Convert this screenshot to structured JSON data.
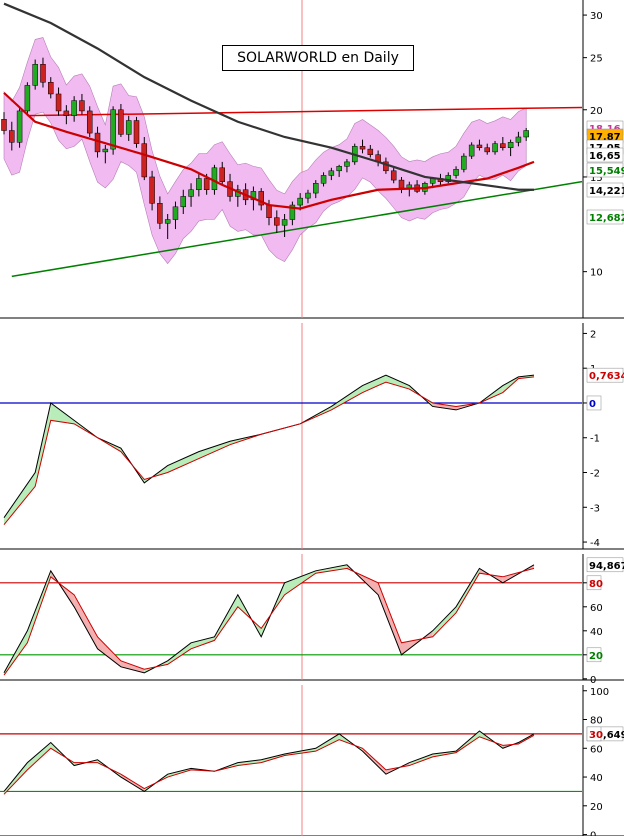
{
  "title": "SOLARWORLD en Daily",
  "chart_data": [
    {
      "type": "candlestick",
      "title": "SOLARWORLD en Daily",
      "yscale": "log",
      "ylim": [
        8.2,
        32
      ],
      "y_ticks": [
        10,
        15,
        20,
        25,
        30
      ],
      "candles": [
        [
          19.2,
          19.8,
          18.0,
          18.3
        ],
        [
          18.3,
          19.0,
          16.8,
          17.4
        ],
        [
          17.4,
          20.2,
          17.0,
          19.9
        ],
        [
          19.9,
          22.5,
          19.5,
          22.2
        ],
        [
          22.2,
          24.8,
          21.8,
          24.3
        ],
        [
          24.3,
          25.0,
          22.0,
          22.5
        ],
        [
          22.5,
          23.0,
          21.0,
          21.4
        ],
        [
          21.4,
          22.0,
          19.5,
          19.9
        ],
        [
          19.9,
          20.4,
          18.8,
          19.5
        ],
        [
          19.5,
          21.2,
          19.0,
          20.8
        ],
        [
          20.8,
          21.4,
          19.6,
          19.9
        ],
        [
          19.9,
          20.3,
          17.8,
          18.1
        ],
        [
          18.1,
          18.6,
          16.3,
          16.7
        ],
        [
          16.7,
          17.2,
          15.9,
          16.9
        ],
        [
          16.9,
          20.3,
          16.5,
          20.0
        ],
        [
          20.0,
          20.5,
          17.8,
          18.0
        ],
        [
          18.0,
          19.5,
          17.5,
          19.1
        ],
        [
          19.1,
          19.4,
          17.0,
          17.3
        ],
        [
          17.3,
          17.8,
          14.8,
          15.0
        ],
        [
          15.0,
          15.4,
          13.0,
          13.4
        ],
        [
          13.4,
          13.8,
          12.0,
          12.3
        ],
        [
          12.3,
          12.8,
          11.5,
          12.5
        ],
        [
          12.5,
          13.5,
          12.0,
          13.2
        ],
        [
          13.2,
          14.2,
          12.8,
          13.8
        ],
        [
          13.8,
          14.6,
          13.2,
          14.2
        ],
        [
          14.2,
          15.2,
          13.8,
          14.9
        ],
        [
          14.9,
          15.2,
          13.9,
          14.2
        ],
        [
          14.2,
          15.8,
          13.9,
          15.6
        ],
        [
          15.6,
          16.0,
          14.5,
          14.7
        ],
        [
          14.7,
          15.2,
          13.5,
          13.8
        ],
        [
          13.8,
          14.5,
          13.2,
          14.2
        ],
        [
          14.2,
          14.6,
          13.3,
          13.6
        ],
        [
          13.6,
          14.4,
          13.0,
          14.1
        ],
        [
          14.1,
          14.3,
          13.0,
          13.3
        ],
        [
          13.3,
          13.6,
          12.2,
          12.6
        ],
        [
          12.6,
          13.0,
          11.8,
          12.2
        ],
        [
          12.2,
          12.8,
          11.6,
          12.5
        ],
        [
          12.5,
          13.5,
          12.2,
          13.3
        ],
        [
          13.3,
          14.0,
          13.0,
          13.7
        ],
        [
          13.7,
          14.2,
          13.4,
          14.0
        ],
        [
          14.0,
          14.8,
          13.7,
          14.6
        ],
        [
          14.6,
          15.3,
          14.4,
          15.1
        ],
        [
          15.1,
          15.6,
          14.8,
          15.4
        ],
        [
          15.4,
          15.8,
          15.0,
          15.7
        ],
        [
          15.7,
          16.2,
          15.3,
          16.0
        ],
        [
          16.0,
          17.3,
          15.8,
          17.1
        ],
        [
          17.1,
          17.6,
          16.6,
          16.9
        ],
        [
          16.9,
          17.2,
          16.3,
          16.5
        ],
        [
          16.5,
          16.8,
          15.7,
          16.0
        ],
        [
          16.0,
          16.3,
          15.2,
          15.4
        ],
        [
          15.4,
          15.7,
          14.6,
          14.8
        ],
        [
          14.8,
          15.0,
          14.0,
          14.3
        ],
        [
          14.3,
          14.7,
          13.8,
          14.5
        ],
        [
          14.5,
          14.8,
          14.0,
          14.1
        ],
        [
          14.1,
          14.7,
          13.9,
          14.6
        ],
        [
          14.6,
          15.0,
          14.3,
          14.9
        ],
        [
          14.9,
          15.2,
          14.5,
          14.7
        ],
        [
          14.7,
          15.3,
          14.6,
          15.1
        ],
        [
          15.1,
          15.7,
          14.9,
          15.5
        ],
        [
          15.5,
          16.6,
          15.3,
          16.4
        ],
        [
          16.4,
          17.4,
          16.2,
          17.2
        ],
        [
          17.2,
          17.6,
          16.8,
          17.0
        ],
        [
          17.0,
          17.3,
          16.5,
          16.7
        ],
        [
          16.7,
          17.5,
          16.5,
          17.3
        ],
        [
          17.3,
          17.8,
          16.8,
          17.0
        ],
        [
          17.0,
          17.6,
          16.4,
          17.4
        ],
        [
          17.4,
          18.2,
          17.1,
          17.8
        ],
        [
          17.8,
          18.5,
          17.5,
          18.3
        ]
      ],
      "series": [
        {
          "name": "",
          "color": "#cc0000",
          "points": [
            [
              0,
              21.5
            ],
            [
              4,
              19.0
            ],
            [
              8,
              18.2
            ],
            [
              12,
              17.5
            ],
            [
              18,
              16.5
            ],
            [
              24,
              15.5
            ],
            [
              28,
              14.5
            ],
            [
              34,
              13.3
            ],
            [
              38,
              13.1
            ],
            [
              42,
              13.6
            ],
            [
              48,
              14.2
            ],
            [
              54,
              14.3
            ],
            [
              58,
              14.6
            ],
            [
              62,
              14.9
            ],
            [
              66,
              15.6
            ],
            [
              68,
              16.0
            ]
          ]
        },
        {
          "name": "",
          "color": "#333333",
          "points": [
            [
              0,
              31.5
            ],
            [
              6,
              29.0
            ],
            [
              12,
              26.0
            ],
            [
              18,
              23.0
            ],
            [
              24,
              20.8
            ],
            [
              30,
              19.0
            ],
            [
              36,
              17.8
            ],
            [
              42,
              17.0
            ],
            [
              48,
              16.0
            ],
            [
              54,
              15.0
            ],
            [
              60,
              14.6
            ],
            [
              66,
              14.2
            ],
            [
              68,
              14.2
            ]
          ]
        }
      ],
      "annotations": [
        "18,16",
        "17,87",
        "17,05",
        "16,65",
        "15,549",
        "14,221",
        "12,682"
      ]
    },
    {
      "type": "line",
      "ylim": [
        -4.2,
        2.3
      ],
      "y_ticks": [
        -4,
        -3,
        -2,
        -1,
        0,
        1,
        2
      ],
      "series": [
        {
          "name": "",
          "color": "#000000",
          "points": [
            [
              0,
              -3.3
            ],
            [
              4,
              -2.0
            ],
            [
              6,
              0.0
            ],
            [
              9,
              -0.5
            ],
            [
              12,
              -1.0
            ],
            [
              15,
              -1.3
            ],
            [
              18,
              -2.3
            ],
            [
              21,
              -1.8
            ],
            [
              25,
              -1.4
            ],
            [
              29,
              -1.1
            ],
            [
              33,
              -0.9
            ],
            [
              38,
              -0.6
            ],
            [
              42,
              -0.1
            ],
            [
              46,
              0.5
            ],
            [
              49,
              0.8
            ],
            [
              52,
              0.5
            ],
            [
              55,
              -0.1
            ],
            [
              58,
              -0.2
            ],
            [
              61,
              0.0
            ],
            [
              64,
              0.5
            ],
            [
              66,
              0.75
            ],
            [
              68,
              0.8
            ]
          ]
        },
        {
          "name": "",
          "color": "#cc0000",
          "points": [
            [
              0,
              -3.5
            ],
            [
              4,
              -2.4
            ],
            [
              6,
              -0.5
            ],
            [
              9,
              -0.6
            ],
            [
              12,
              -1.0
            ],
            [
              15,
              -1.4
            ],
            [
              18,
              -2.2
            ],
            [
              21,
              -2.0
            ],
            [
              25,
              -1.6
            ],
            [
              29,
              -1.2
            ],
            [
              33,
              -0.9
            ],
            [
              38,
              -0.6
            ],
            [
              42,
              -0.2
            ],
            [
              46,
              0.3
            ],
            [
              49,
              0.6
            ],
            [
              52,
              0.4
            ],
            [
              55,
              0.0
            ],
            [
              58,
              -0.1
            ],
            [
              61,
              0.0
            ],
            [
              64,
              0.3
            ],
            [
              66,
              0.7
            ],
            [
              68,
              0.75
            ]
          ]
        }
      ],
      "hlines": [
        0
      ],
      "annotations": [
        "0,7634",
        "0"
      ]
    },
    {
      "type": "line",
      "ylim": [
        -1,
        104
      ],
      "y_ticks": [
        0,
        20,
        40,
        60,
        80
      ],
      "series": [
        {
          "name": "",
          "color": "#000000",
          "points": [
            [
              0,
              5
            ],
            [
              3,
              40
            ],
            [
              6,
              90
            ],
            [
              9,
              60
            ],
            [
              12,
              25
            ],
            [
              15,
              10
            ],
            [
              18,
              5
            ],
            [
              21,
              15
            ],
            [
              24,
              30
            ],
            [
              27,
              35
            ],
            [
              30,
              70
            ],
            [
              33,
              35
            ],
            [
              36,
              80
            ],
            [
              40,
              90
            ],
            [
              44,
              95
            ],
            [
              48,
              70
            ],
            [
              51,
              20
            ],
            [
              55,
              40
            ],
            [
              58,
              60
            ],
            [
              61,
              92
            ],
            [
              64,
              80
            ],
            [
              68,
              95
            ]
          ]
        },
        {
          "name": "",
          "color": "#cc0000",
          "points": [
            [
              0,
              3
            ],
            [
              3,
              30
            ],
            [
              6,
              85
            ],
            [
              9,
              70
            ],
            [
              12,
              35
            ],
            [
              15,
              15
            ],
            [
              18,
              8
            ],
            [
              21,
              12
            ],
            [
              24,
              25
            ],
            [
              27,
              32
            ],
            [
              30,
              60
            ],
            [
              33,
              42
            ],
            [
              36,
              70
            ],
            [
              40,
              88
            ],
            [
              44,
              92
            ],
            [
              48,
              80
            ],
            [
              51,
              30
            ],
            [
              55,
              35
            ],
            [
              58,
              55
            ],
            [
              61,
              88
            ],
            [
              64,
              85
            ],
            [
              68,
              92
            ]
          ]
        }
      ],
      "hlines": [
        80,
        20
      ],
      "annotations": [
        "94,867",
        "80",
        "20"
      ]
    },
    {
      "type": "line",
      "ylim": [
        -1,
        104
      ],
      "y_ticks": [
        0,
        20,
        40,
        60,
        80,
        100
      ],
      "series": [
        {
          "name": "",
          "color": "#000000",
          "points": [
            [
              0,
              30
            ],
            [
              3,
              50
            ],
            [
              6,
              64
            ],
            [
              9,
              48
            ],
            [
              12,
              52
            ],
            [
              15,
              40
            ],
            [
              18,
              30
            ],
            [
              21,
              42
            ],
            [
              24,
              46
            ],
            [
              27,
              44
            ],
            [
              30,
              50
            ],
            [
              33,
              52
            ],
            [
              36,
              56
            ],
            [
              40,
              60
            ],
            [
              43,
              70
            ],
            [
              46,
              58
            ],
            [
              49,
              42
            ],
            [
              52,
              50
            ],
            [
              55,
              56
            ],
            [
              58,
              58
            ],
            [
              61,
              72
            ],
            [
              64,
              60
            ],
            [
              66,
              64
            ],
            [
              68,
              70
            ]
          ]
        },
        {
          "name": "",
          "color": "#cc0000",
          "points": [
            [
              0,
              28
            ],
            [
              3,
              45
            ],
            [
              6,
              60
            ],
            [
              9,
              50
            ],
            [
              12,
              50
            ],
            [
              15,
              42
            ],
            [
              18,
              32
            ],
            [
              21,
              40
            ],
            [
              24,
              45
            ],
            [
              27,
              44
            ],
            [
              30,
              48
            ],
            [
              33,
              50
            ],
            [
              36,
              55
            ],
            [
              40,
              58
            ],
            [
              43,
              66
            ],
            [
              46,
              60
            ],
            [
              49,
              45
            ],
            [
              52,
              48
            ],
            [
              55,
              54
            ],
            [
              58,
              57
            ],
            [
              61,
              68
            ],
            [
              64,
              62
            ],
            [
              66,
              63
            ],
            [
              68,
              69
            ]
          ]
        }
      ],
      "hlines": [
        70,
        30
      ],
      "annotations": [
        "70,649",
        "30"
      ]
    }
  ]
}
